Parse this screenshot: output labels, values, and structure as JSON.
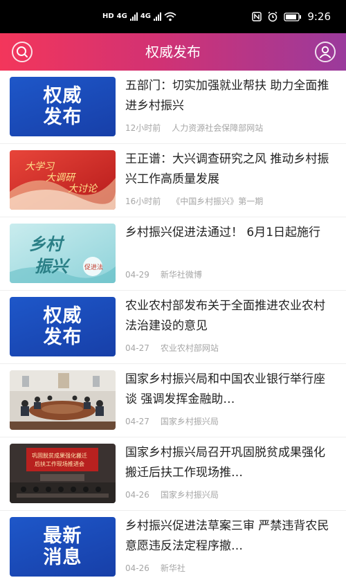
{
  "status_bar": {
    "left_badges": [
      "HD",
      "4G",
      "4G"
    ],
    "time": "9:26",
    "icons": [
      "hd-icon",
      "signal-icon",
      "wifi-icon",
      "nfc-icon",
      "alarm-icon",
      "battery-icon"
    ]
  },
  "header": {
    "title": "权威发布",
    "gradient": [
      "#f3365b",
      "#d23273",
      "#9a3a9c"
    ],
    "left_icon": "search-icon",
    "right_icon": "user-icon"
  },
  "news": [
    {
      "title": "五部门：切实加强就业帮扶 助力全面推进乡村振兴",
      "time": "12小时前",
      "source": "人力资源社会保障部网站",
      "thumb_type": "badge",
      "thumb_lines": [
        "权威",
        "发布"
      ]
    },
    {
      "title": "王正谱：大兴调查研究之风 推动乡村振兴工作高质量发展",
      "time": "16小时前",
      "source": "《中国乡村振兴》第一期",
      "thumb_type": "banner",
      "thumb_lines": [
        "大学习",
        "大调研",
        "大讨论"
      ]
    },
    {
      "title": "乡村振兴促进法通过！ 6月1日起施行",
      "time": "04-29",
      "source": "新华社微博",
      "thumb_type": "calligraphy",
      "thumb_lines": [
        "乡村",
        "振兴",
        "促进法"
      ]
    },
    {
      "title": "农业农村部发布关于全面推进农业农村法治建设的意见",
      "time": "04-27",
      "source": "农业农村部网站",
      "thumb_type": "badge",
      "thumb_lines": [
        "权威",
        "发布"
      ]
    },
    {
      "title": "国家乡村振兴局和中国农业银行举行座谈 强调发挥金融助…",
      "time": "04-27",
      "source": "国家乡村振兴局",
      "thumb_type": "meeting-photo",
      "thumb_lines": []
    },
    {
      "title": "国家乡村振兴局召开巩固脱贫成果强化搬迁后扶工作现场推…",
      "time": "04-26",
      "source": "国家乡村振兴局",
      "thumb_type": "conference-photo",
      "thumb_lines": [
        "巩固脱贫成果强化搬迁",
        "后扶工作现场推进会"
      ]
    },
    {
      "title": "乡村振兴促进法草案三审 严禁违背农民意愿违反法定程序撤…",
      "time": "04-26",
      "source": "新华社",
      "thumb_type": "badge",
      "thumb_lines": [
        "最新",
        "消息"
      ]
    }
  ]
}
